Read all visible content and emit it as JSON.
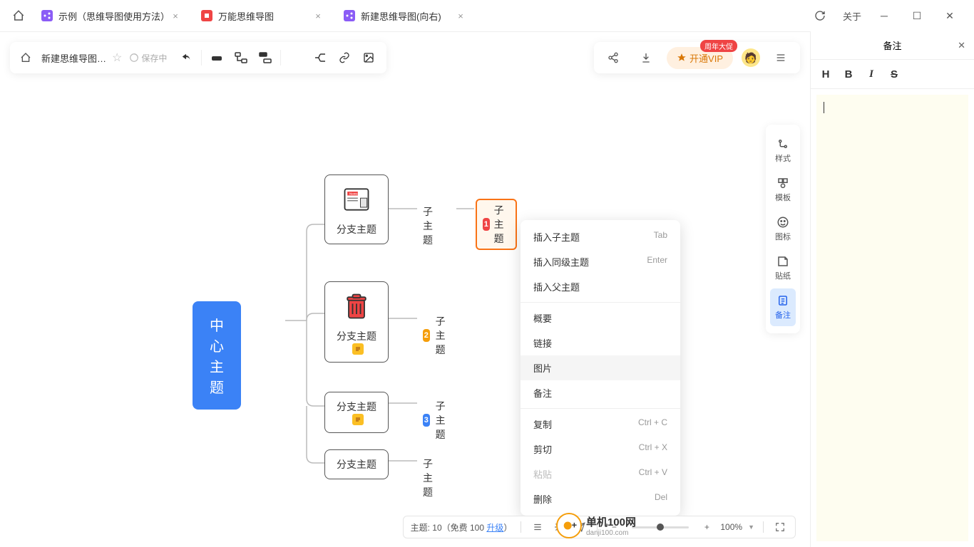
{
  "titlebar": {
    "tabs": [
      {
        "label": "示例（思维导图使用方法）",
        "icon": "purple"
      },
      {
        "label": "万能思维导图",
        "icon": "red"
      },
      {
        "label": "新建思维导图(向右)",
        "icon": "purple",
        "active": true
      }
    ],
    "about": "关于"
  },
  "toolbar": {
    "doc_title": "新建思维导图(向...",
    "save_status": "保存中"
  },
  "vip": {
    "label": "开通VIP",
    "badge": "周年大促"
  },
  "sidebar": {
    "items": [
      {
        "label": "样式"
      },
      {
        "label": "模板"
      },
      {
        "label": "图标"
      },
      {
        "label": "贴纸"
      },
      {
        "label": "备注",
        "active": true
      }
    ]
  },
  "mindmap": {
    "central": "中心主题",
    "branches": [
      {
        "label": "分支主题",
        "sub": "子主题",
        "sub2": "子主题",
        "num": "1"
      },
      {
        "label": "分支主题",
        "sub": "子主题",
        "num": "2"
      },
      {
        "label": "分支主题",
        "sub": "子主题",
        "num": "3"
      },
      {
        "label": "分支主题",
        "sub": "子主题"
      }
    ]
  },
  "context_menu": {
    "insert_child": "插入子主题",
    "insert_sibling": "插入同级主题",
    "insert_parent": "插入父主题",
    "summary": "概要",
    "link": "链接",
    "image": "图片",
    "note": "备注",
    "copy": "复制",
    "cut": "剪切",
    "paste": "粘贴",
    "delete": "删除",
    "sc_tab": "Tab",
    "sc_enter": "Enter",
    "sc_copy": "Ctrl + C",
    "sc_cut": "Ctrl + X",
    "sc_paste": "Ctrl + V",
    "sc_del": "Del"
  },
  "bottom": {
    "topic_label": "主题: 10（免费 100 ",
    "upgrade": "升级",
    "close_paren": "）",
    "zoom": "100%"
  },
  "notes": {
    "title": "备注"
  },
  "watermark": {
    "text": "单机100网",
    "sub": "danji100.com"
  }
}
